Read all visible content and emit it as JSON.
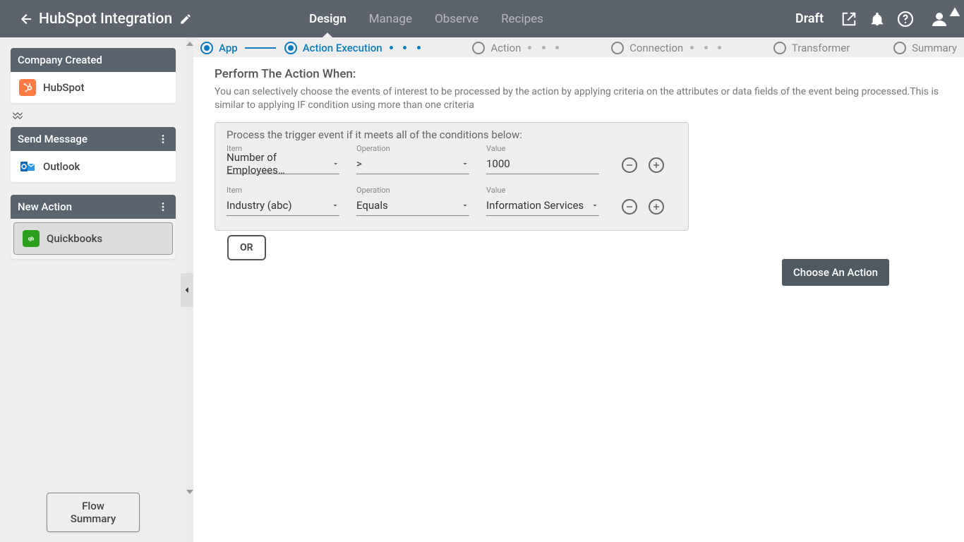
{
  "topbar": {
    "title": "HubSpot Integration",
    "tabs": [
      "Design",
      "Manage",
      "Observe",
      "Recipes"
    ],
    "active_tab": 0,
    "status": "Draft"
  },
  "sidebar": {
    "cards": [
      {
        "title": "Company Created",
        "app": "HubSpot",
        "has_menu": false
      },
      {
        "title": "Send Message",
        "app": "Outlook",
        "has_menu": true
      },
      {
        "title": "New Action",
        "app": "Quickbooks",
        "has_menu": true,
        "selected": true
      }
    ],
    "flow_summary_label": "Flow Summary"
  },
  "stepper": {
    "steps": [
      "App",
      "Action Execution",
      "Action",
      "Connection",
      "Transformer",
      "Summary"
    ],
    "active": 1
  },
  "panel": {
    "heading": "Perform The Action When:",
    "description": "You can selectively choose the events of interest to be processed by the action by applying criteria on the attributes or data fields of the event being processed.This is similar to applying IF condition using more than one criteria",
    "caption": "Process the trigger event if it meets all of the conditions below:",
    "labels": {
      "item": "Item",
      "operation": "Operation",
      "value": "Value"
    },
    "rows": [
      {
        "item": "Number of Employees…",
        "operation": ">",
        "value": "1000",
        "value_type": "text"
      },
      {
        "item": "Industry (abc)",
        "operation": "Equals",
        "value": "Information Services",
        "value_type": "select"
      }
    ],
    "or_label": "OR",
    "choose_label": "Choose An Action"
  }
}
